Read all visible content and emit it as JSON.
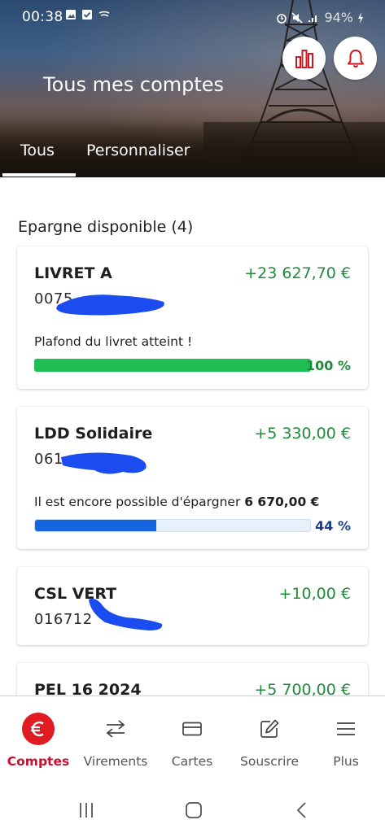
{
  "status_bar": {
    "time": "00:38",
    "battery": "94%"
  },
  "header": {
    "title": "Tous mes comptes",
    "tabs": [
      {
        "label": "Tous",
        "active": true
      },
      {
        "label": "Personnaliser",
        "active": false
      }
    ]
  },
  "section": {
    "title": "Epargne disponible (4)"
  },
  "accounts": [
    {
      "name": "LIVRET A",
      "number_visible": "0075",
      "amount": "+23 627,70 €",
      "note": "Plafond du livret atteint !",
      "progress_pct": 100,
      "progress_label": "100 %",
      "progress_color": "#1fbf55",
      "pct_color": "#1f8a3a"
    },
    {
      "name": "LDD Solidaire",
      "number_visible": "061",
      "amount": "+5 330,00 €",
      "note_prefix": "Il est encore possible d'épargner ",
      "note_bold": "6 670,00 €",
      "progress_pct": 44,
      "progress_label": "44 %",
      "progress_color": "#1565e0",
      "pct_color": "#1a3f8f"
    },
    {
      "name": "CSL VERT",
      "number_visible": "016712",
      "amount": "+10,00 €"
    },
    {
      "name": "PEL 16 2024",
      "amount": "+5 700,00 €"
    }
  ],
  "bottom_nav": [
    {
      "label": "Comptes",
      "icon": "euro-icon",
      "active": true
    },
    {
      "label": "Virements",
      "icon": "transfer-arrows-icon",
      "active": false
    },
    {
      "label": "Cartes",
      "icon": "card-icon",
      "active": false
    },
    {
      "label": "Souscrire",
      "icon": "edit-icon",
      "active": false
    },
    {
      "label": "Plus",
      "icon": "menu-icon",
      "active": false
    }
  ],
  "colors": {
    "brand_red": "#e11b22",
    "amount_green": "#1f8a3a",
    "redaction_blue": "#1a4cf0"
  }
}
